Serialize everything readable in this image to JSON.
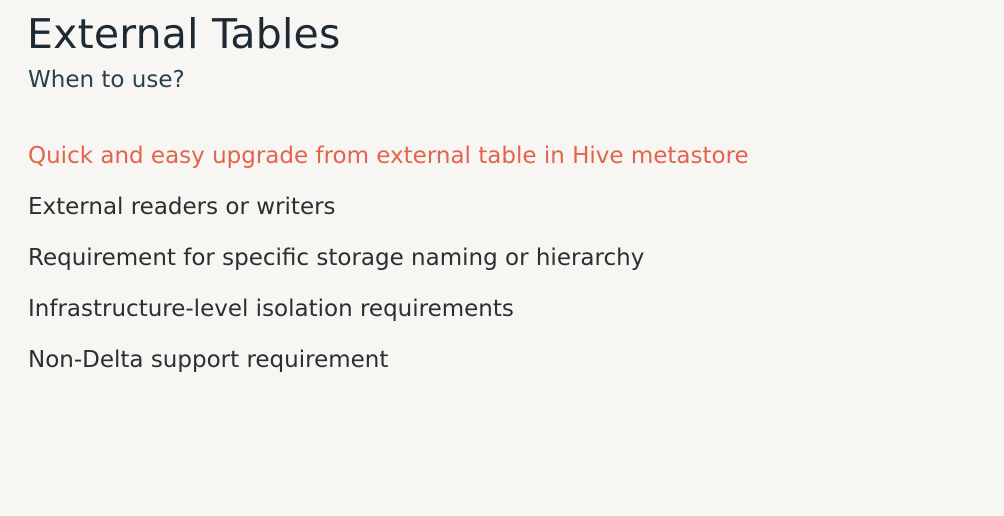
{
  "slide": {
    "title": "External Tables",
    "subtitle": "When to use?",
    "bullets": [
      "Quick and easy upgrade from external table in Hive metastore",
      "External readers or writers",
      "Requirement for specific storage naming or hierarchy",
      "Infrastructure-level isolation requirements",
      "Non-Delta support requirement"
    ],
    "colors": {
      "background": "#f7f6f2",
      "title": "#1e2a33",
      "subtitle": "#27414d",
      "text": "#2b2f32",
      "highlight": "#e1654e"
    }
  }
}
